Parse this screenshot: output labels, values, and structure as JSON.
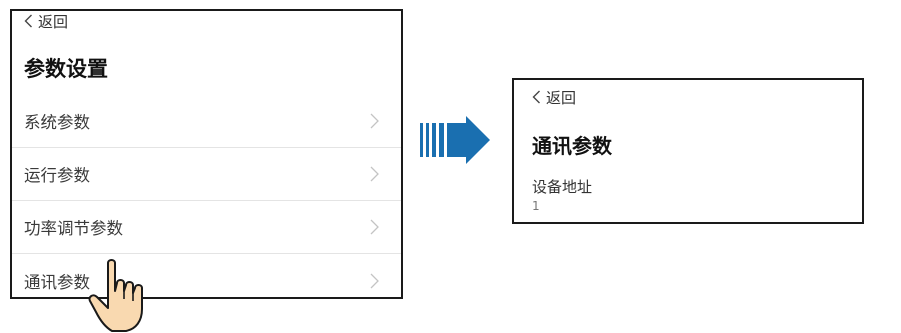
{
  "left_screen": {
    "back_label": "返回",
    "title": "参数设置",
    "items": [
      {
        "label": "系统参数"
      },
      {
        "label": "运行参数"
      },
      {
        "label": "功率调节参数"
      },
      {
        "label": "通讯参数"
      }
    ]
  },
  "right_screen": {
    "back_label": "返回",
    "title": "通讯参数",
    "field": {
      "label": "设备地址",
      "value": "1"
    }
  },
  "icons": {
    "back": "chevron-left-icon",
    "item": "chevron-right-icon",
    "transition": "arrow-right-icon",
    "pointer": "hand-pointer-icon"
  },
  "colors": {
    "arrow": "#1a6fb0",
    "hand_fill": "#f9d9b0",
    "border": "#1a1a1a"
  }
}
